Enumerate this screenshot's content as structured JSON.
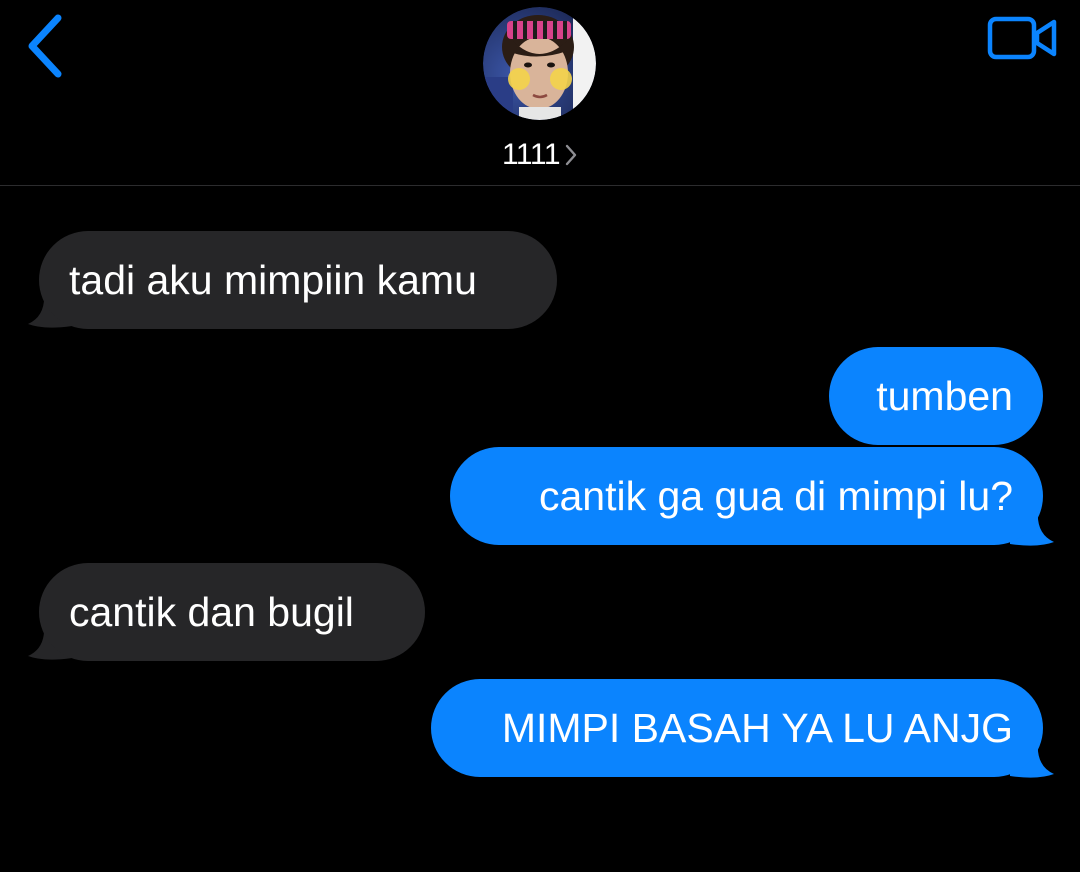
{
  "header": {
    "back_icon": "chevron-left-icon",
    "video_icon": "video-camera-icon",
    "contact_name": "1111",
    "chevron_icon": "chevron-right-icon"
  },
  "messages": [
    {
      "direction": "received",
      "text": "tadi aku mimpiin kamu"
    },
    {
      "direction": "sent",
      "text": "tumben"
    },
    {
      "direction": "sent",
      "text": "cantik ga gua di mimpi lu?"
    },
    {
      "direction": "received",
      "text": "cantik dan bugil"
    },
    {
      "direction": "sent",
      "text": "MIMPI BASAH YA LU ANJG"
    }
  ],
  "colors": {
    "background": "#000000",
    "accent": "#0b84fe",
    "received_bubble": "#262628",
    "sent_bubble": "#0b84fe",
    "text": "#ffffff"
  }
}
